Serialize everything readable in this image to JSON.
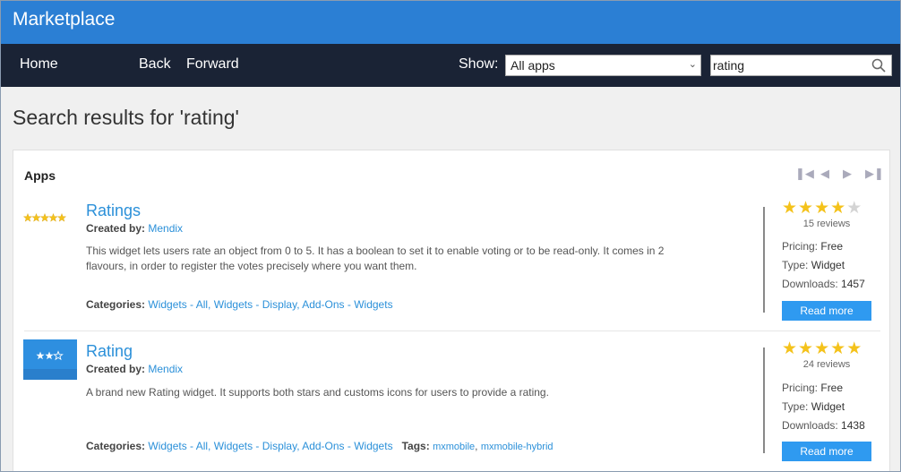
{
  "window": {
    "title": "Marketplace"
  },
  "nav": {
    "home": "Home",
    "back": "Back",
    "forward": "Forward",
    "show_label": "Show:",
    "show_select": "All apps",
    "search_value": "rating"
  },
  "heading": "Search results for 'rating'",
  "panel": {
    "title": "Apps",
    "apps": [
      {
        "name": "Ratings",
        "created_label": "Created by:",
        "creator": "Mendix",
        "description": "This widget lets users rate an object from 0 to 5. It has a boolean to set it to enable voting or to be read-only. It comes in 2 flavours, in order to register the votes precisely where you want them.",
        "categories_label": "Categories:",
        "categories": "Widgets - All, Widgets - Display, Add-Ons - Widgets",
        "rating": 4,
        "reviews": "15 reviews",
        "pricing_label": "Pricing:",
        "pricing": "Free",
        "type_label": "Type:",
        "type": "Widget",
        "downloads_label": "Downloads:",
        "downloads": "1457",
        "button": "Read more"
      },
      {
        "name": "Rating",
        "created_label": "Created by:",
        "creator": "Mendix",
        "description": "A brand new Rating widget. It supports both stars and customs icons for users to provide a rating.",
        "categories_label": "Categories:",
        "categories": "Widgets - All, Widgets - Display, Add-Ons - Widgets",
        "tags_label": "Tags:",
        "tag1": "mxmobile",
        "tag_sep": ",",
        "tag2": "mxmobile-hybrid",
        "rating": 5,
        "reviews": "24 reviews",
        "pricing_label": "Pricing:",
        "pricing": "Free",
        "type_label": "Type:",
        "type": "Widget",
        "downloads_label": "Downloads:",
        "downloads": "1438",
        "button": "Read more"
      }
    ]
  },
  "colors": {
    "titlebar": "#2b7fd4",
    "navbar": "#1a2335",
    "link": "#2b90d9",
    "star": "#f4c21b",
    "button": "#2f9af0"
  }
}
